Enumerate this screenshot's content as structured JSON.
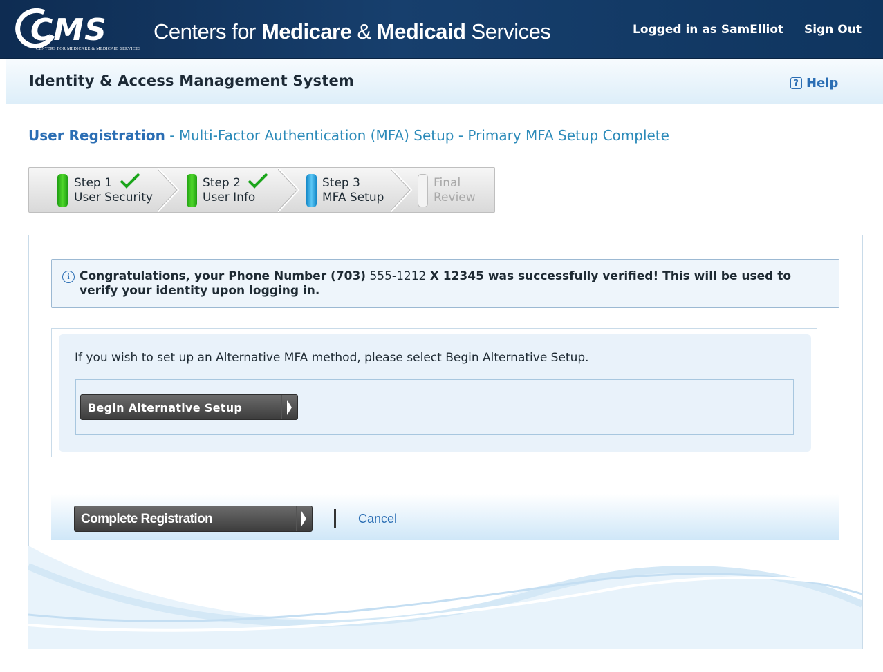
{
  "header": {
    "logo_letters": "CMS",
    "logo_subtext": "CENTERS FOR MEDICARE & MEDICAID SERVICES",
    "title_prefix": "Centers for ",
    "title_bold1": "Medicare",
    "title_amp": " & ",
    "title_bold2": "Medicaid",
    "title_suffix": " Services",
    "logged_in": "Logged in as SamElliot",
    "sign_out": "Sign Out"
  },
  "system": {
    "title": "Identity & Access Management System",
    "help": "Help"
  },
  "page": {
    "heading_main": "User Registration",
    "heading_sub": " - Multi-Factor Authentication (MFA) Setup - Primary MFA Setup Complete"
  },
  "steps": [
    {
      "line1": "Step 1",
      "line2": "User Security",
      "status": "complete"
    },
    {
      "line1": "Step 2",
      "line2": "User Info",
      "status": "complete"
    },
    {
      "line1": "Step 3",
      "line2": "MFA Setup",
      "status": "current"
    },
    {
      "line1": "Final",
      "line2": "Review",
      "status": "pending"
    }
  ],
  "notice": {
    "text_a": "Congratulations, your Phone Number (703)",
    "phone": " 555-1212 ",
    "text_b": " X 12345 was successfully verified! This will be used to verify your identity upon logging in."
  },
  "alternative": {
    "instruction": "If you wish to set up an Alternative MFA method, please select Begin Alternative Setup.",
    "button": "Begin Alternative Setup"
  },
  "actions": {
    "complete": "Complete Registration",
    "cancel": "Cancel"
  },
  "colors": {
    "banner": "#173f6d",
    "link": "#2b6eb4",
    "step_complete": "#2fbf1a",
    "step_current": "#2aa6e6"
  }
}
